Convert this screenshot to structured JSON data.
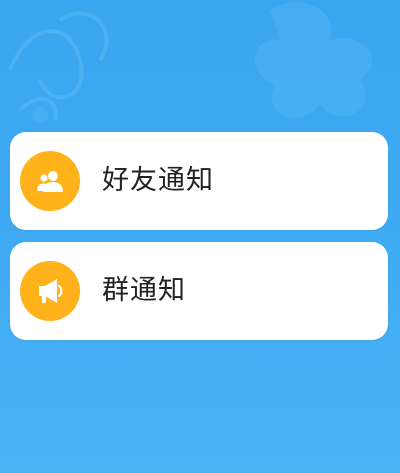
{
  "colors": {
    "background": "#3daaf2",
    "card": "#ffffff",
    "icon_accent": "#ffb21a",
    "text": "#222222"
  },
  "notifications": {
    "items": [
      {
        "label": "好友通知",
        "icon": "friends-icon"
      },
      {
        "label": "群通知",
        "icon": "megaphone-icon"
      }
    ]
  }
}
